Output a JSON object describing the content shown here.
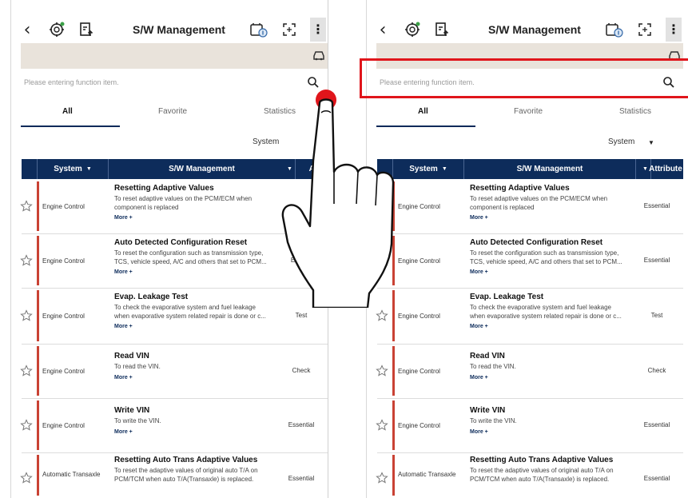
{
  "app_title": "S/W Management",
  "search": {
    "placeholder": "Please entering function item."
  },
  "tabs": [
    "All",
    "Favorite",
    "Statistics"
  ],
  "sort": {
    "label": "System"
  },
  "columns": {
    "system": "System",
    "sw": "S/W Management",
    "attribute_left": "Attrib",
    "attribute_right": "Attribute"
  },
  "more_label": "More +",
  "rows": [
    {
      "system": "Engine Control",
      "name": "Resetting Adaptive Values",
      "desc1": "To reset adaptive values on the PCM/ECM when",
      "desc2": "component is replaced",
      "attr": "Essential"
    },
    {
      "system": "Engine Control",
      "name": "Auto Detected Configuration Reset",
      "desc1": "To reset the configuration such as transmission type,",
      "desc2": "TCS, vehicle speed, A/C and others that set to PCM...",
      "attr": "Essential"
    },
    {
      "system": "Engine Control",
      "name": "Evap. Leakage Test",
      "desc1": "To check the evaporative system and fuel leakage",
      "desc2": "when evaporative system related repair is done or c...",
      "attr": "Test"
    },
    {
      "system": "Engine Control",
      "name": "Read VIN",
      "desc1": "To read the VIN.",
      "desc2": "",
      "attr": "Check"
    },
    {
      "system": "Engine Control",
      "name": "Write VIN",
      "desc1": "To write the VIN.",
      "desc2": "",
      "attr": "Essential"
    },
    {
      "system": "Automatic Transaxle",
      "name": "Resetting Auto Trans Adaptive Values",
      "desc1": "To reset the adaptive values of original auto T/A on",
      "desc2": "PCM/TCM when auto T/A(Transaxle) is replaced.",
      "attr": "Essential"
    }
  ],
  "left_attrs": [
    "",
    "Essenti",
    "Test",
    "Check",
    "Essential",
    "Essential"
  ],
  "colors": {
    "header_navy": "#0d2c5b",
    "row_marker": "#c94234",
    "highlight": "#e0151b",
    "tap_dot": "#e0151b",
    "vehicle_bar": "#e9e3db"
  }
}
